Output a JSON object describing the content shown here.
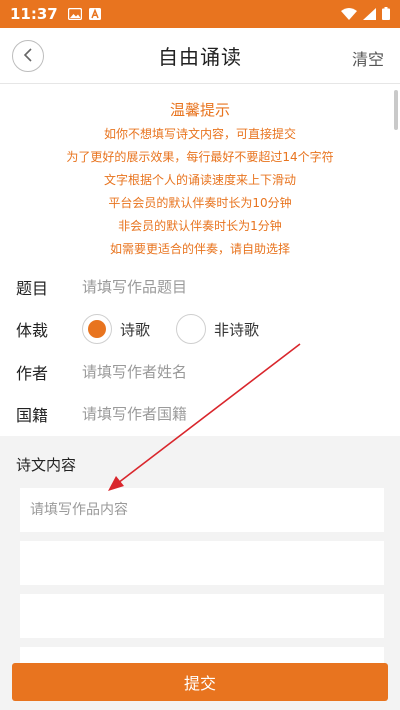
{
  "status_bar": {
    "time": "11:37",
    "icons_left": [
      "image-icon",
      "a-icon"
    ],
    "icons_right": [
      "wifi-icon",
      "signal-icon",
      "battery-icon"
    ]
  },
  "nav": {
    "title": "自由诵读",
    "clear_label": "清空",
    "back_icon": "chevron-left-icon"
  },
  "tips": {
    "title": "温馨提示",
    "lines": [
      "如你不想填写诗文内容，可直接提交",
      "为了更好的展示效果，每行最好不要超过14个字符",
      "文字根据个人的诵读速度来上下滑动",
      "平台会员的默认伴奏时长为10分钟",
      "非会员的默认伴奏时长为1分钟",
      "如需要更适合的伴奏，请自助选择"
    ]
  },
  "form": {
    "title_label": "题目",
    "title_placeholder": "请填写作品题目",
    "genre_label": "体裁",
    "genre_options": [
      {
        "label": "诗歌",
        "selected": true
      },
      {
        "label": "非诗歌",
        "selected": false
      }
    ],
    "author_label": "作者",
    "author_placeholder": "请填写作者姓名",
    "nationality_label": "国籍",
    "nationality_placeholder": "请填写作者国籍"
  },
  "content": {
    "label": "诗文内容",
    "first_placeholder": "请填写作品内容"
  },
  "submit_label": "提交",
  "colors": {
    "accent": "#e8741f",
    "annotation_arrow": "#d9262c"
  }
}
